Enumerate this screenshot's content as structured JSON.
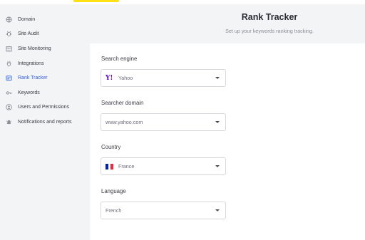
{
  "sidebar": {
    "items": [
      {
        "label": "Domain",
        "icon": "globe-icon"
      },
      {
        "label": "Site Audit",
        "icon": "bug-icon"
      },
      {
        "label": "Site Monitoring",
        "icon": "calendar-icon"
      },
      {
        "label": "Integrations",
        "icon": "plug-icon"
      },
      {
        "label": "Rank Tracker",
        "icon": "tracker-icon",
        "active": true
      },
      {
        "label": "Keywords",
        "icon": "key-icon"
      },
      {
        "label": "Users and Permissions",
        "icon": "user-icon"
      },
      {
        "label": "Notifications and reports",
        "icon": "bell-icon"
      }
    ]
  },
  "header": {
    "title": "Rank Tracker",
    "subtitle": "Set up your keywords ranking tracking."
  },
  "form": {
    "search_engine": {
      "label": "Search engine",
      "value": "Yahoo",
      "logo_text": "Y!"
    },
    "searcher_domain": {
      "label": "Searcher domain",
      "value": "www.yahoo.com"
    },
    "country": {
      "label": "Country",
      "value": "France"
    },
    "language": {
      "label": "Language",
      "value": "French"
    }
  },
  "colors": {
    "accent": "#2f5fd6",
    "topbar_accent": "#ffe014",
    "sidebar_bg": "#f3f4f6",
    "yahoo_purple": "#6001d2",
    "flag_blue": "#002395",
    "flag_white": "#ffffff",
    "flag_red": "#ed2939"
  }
}
